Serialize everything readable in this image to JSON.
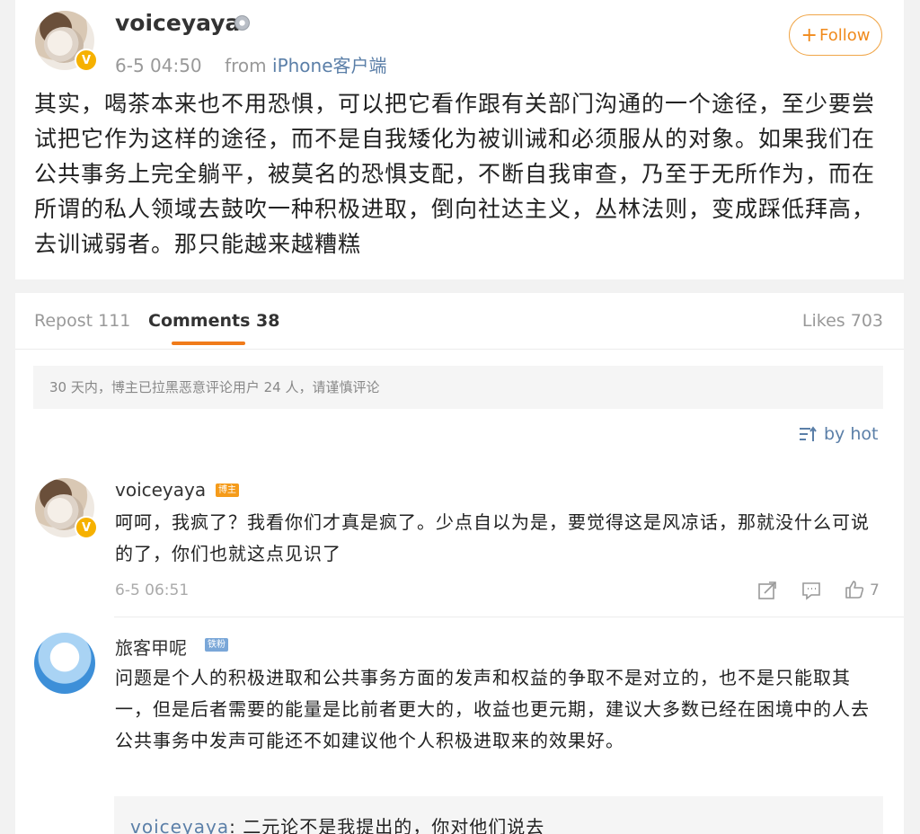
{
  "post": {
    "username": "voiceyaya",
    "time": "6-5 04:50",
    "from_label": "from",
    "source": "iPhone客户端",
    "follow_label": "Follow",
    "text": "其实，喝茶本来也不用恐惧，可以把它看作跟有关部门沟通的一个途径，至少要尝试把它作为这样的途径，而不是自我矮化为被训诫和必须服从的对象。如果我们在公共事务上完全躺平，被莫名的恐惧支配，不断自我审查，乃至于无所作为，而在所谓的私人领域去鼓吹一种积极进取，倒向社达主义，丛林法则，变成踩低拜高，去训诫弱者。那只能越来越糟糕"
  },
  "tabs": {
    "repost": "Repost 111",
    "comments": "Comments 38",
    "likes": "Likes 703"
  },
  "notice": "30 天内，博主已拉黑恶意评论用户 24 人，请谨慎评论",
  "sort_label": "by hot",
  "comments": [
    {
      "username": "voiceyaya",
      "tag": "博主",
      "text": "呵呵，我疯了？我看你们才真是疯了。少点自以为是，要觉得这是风凉话，那就没什么可说的了，你们也就这点见识了",
      "time": "6-5 06:51",
      "likes": "7"
    },
    {
      "username": "旅客甲呢",
      "tag": "铁粉",
      "text": "问题是个人的积极进取和公共事务方面的发声和权益的争取不是对立的，也不是只能取其一，但是后者需要的能量是比前者更大的，收益也更元期，建议大多数已经在困境中的人去公共事务中发声可能还不如建议他个人积极进取来的效果好。",
      "reply": {
        "username": "voiceyaya",
        "separator": ": ",
        "text": "二元论不是我提出的，你对他们说去"
      }
    }
  ],
  "colors": {
    "accent_orange": "#f07b1a",
    "link_blue": "#5b7fa8",
    "badge_yellow": "#f6b100"
  }
}
